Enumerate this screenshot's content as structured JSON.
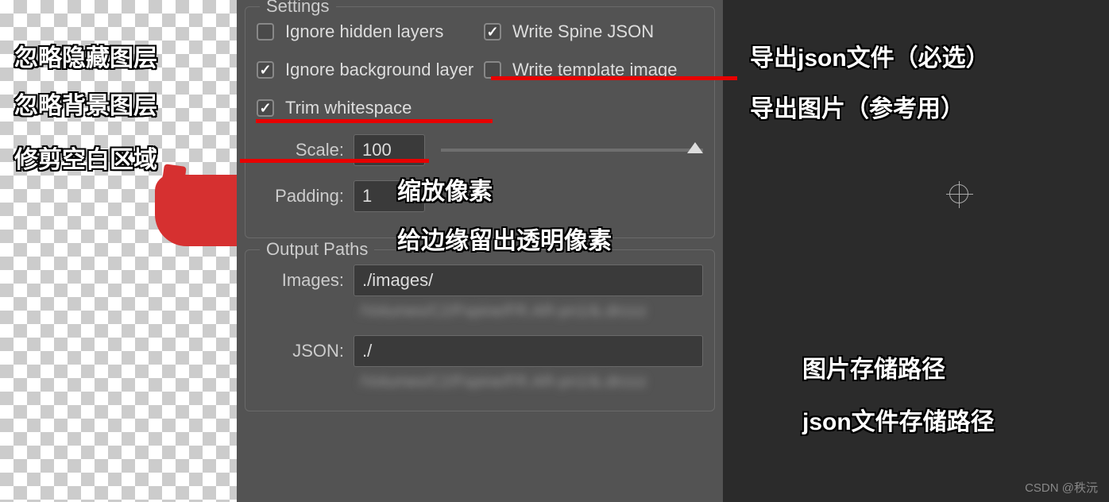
{
  "settings": {
    "title": "Settings",
    "checkboxes": {
      "ignore_hidden": {
        "label": "Ignore hidden layers",
        "checked": false
      },
      "write_json": {
        "label": "Write Spine JSON",
        "checked": true
      },
      "ignore_bg": {
        "label": "Ignore background layer",
        "checked": true
      },
      "write_template": {
        "label": "Write template image",
        "checked": false
      },
      "trim_ws": {
        "label": "Trim whitespace",
        "checked": true
      }
    },
    "scale": {
      "label": "Scale:",
      "value": "100"
    },
    "padding": {
      "label": "Padding:",
      "value": "1"
    }
  },
  "output": {
    "title": "Output Paths",
    "images": {
      "label": "Images:",
      "value": "./images/"
    },
    "json": {
      "label": "JSON:",
      "value": "./"
    }
  },
  "annotations": {
    "ignore_hidden": "忽略隐藏图层",
    "ignore_bg": "忽略背景图层",
    "trim_ws": "修剪空白区域",
    "scale": "缩放像素",
    "padding": "给边缘留出透明像素",
    "write_json": "导出json文件（必选）",
    "write_template": "导出图片（参考用）",
    "images_path": "图片存储路径",
    "json_path": "json文件存储路径"
  },
  "watermark": "CSDN @秩沅"
}
